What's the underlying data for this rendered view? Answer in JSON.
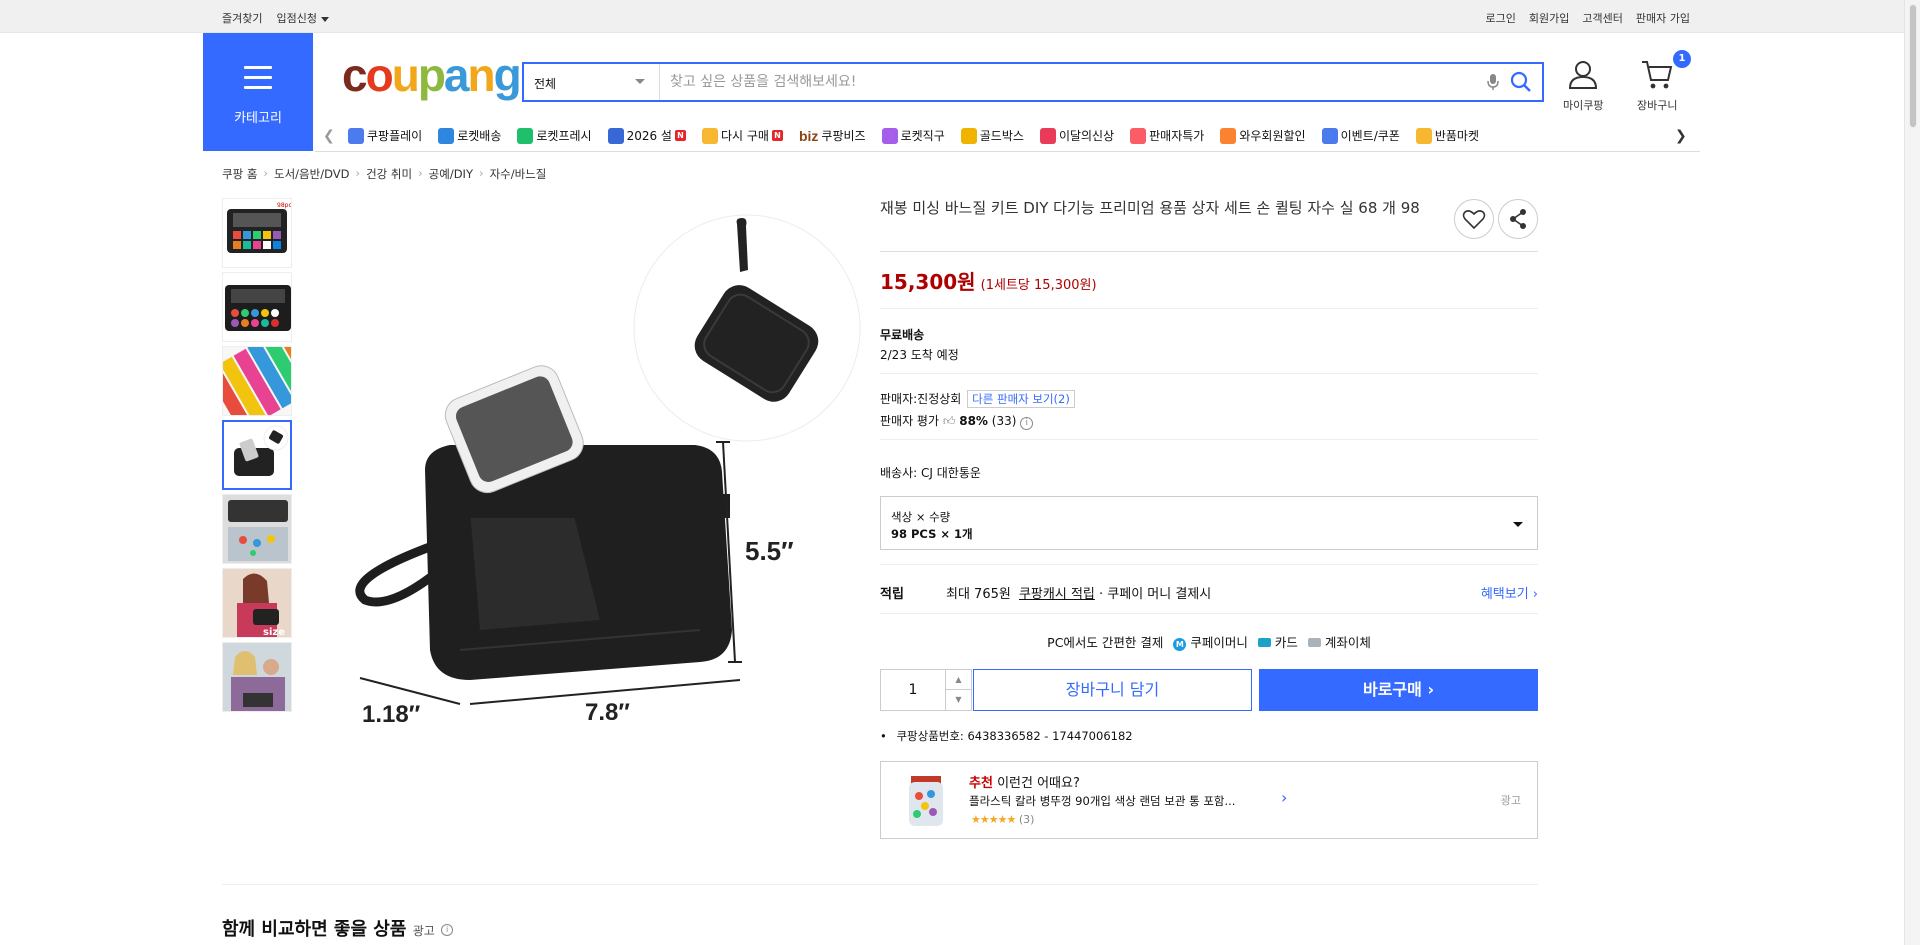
{
  "topbar": {
    "favorites": "즐겨찾기",
    "vendor_apply": "입점신청",
    "login": "로그인",
    "signup": "회원가입",
    "customer_center": "고객센터",
    "seller_join": "판매자 가입"
  },
  "header": {
    "category_label": "카테고리",
    "logo_parts": [
      "c",
      "o",
      "u",
      "p",
      "a",
      "n",
      "g"
    ],
    "search_category": "전체",
    "search_placeholder": "찾고 싶은 상품을 검색해보세요!",
    "mycoupang": "마이쿠팡",
    "cart": "장바구니",
    "cart_count": "1"
  },
  "nav": {
    "items": [
      {
        "label": "쿠팡플레이",
        "icon": "coupang-play-icon",
        "color": "#4b7bec"
      },
      {
        "label": "로켓배송",
        "icon": "rocket-icon",
        "color": "#2e86de"
      },
      {
        "label": "로켓프레시",
        "icon": "rocket-fresh-icon",
        "color": "#20bf6b"
      },
      {
        "label": "2026 설",
        "icon": "newyear-icon",
        "color": "#3867d6",
        "badge": "N"
      },
      {
        "label": "다시 구매",
        "icon": "home-icon",
        "color": "#f7b731",
        "badge": "N"
      },
      {
        "label": "쿠팡비즈",
        "icon": "biz-icon",
        "color": "#8b4513",
        "prefix": "biz"
      },
      {
        "label": "로켓직구",
        "icon": "rocket-global-icon",
        "color": "#a55eea"
      },
      {
        "label": "골드박스",
        "icon": "goldbox-icon",
        "color": "#f0b400"
      },
      {
        "label": "이달의신상",
        "icon": "new-items-icon",
        "color": "#eb3b5a"
      },
      {
        "label": "판매자특가",
        "icon": "seller-deal-icon",
        "color": "#fc5c65"
      },
      {
        "label": "와우회원할인",
        "icon": "wow-icon",
        "color": "#fa8231"
      },
      {
        "label": "이벤트/쿠폰",
        "icon": "coupon-icon",
        "color": "#4b7bec"
      },
      {
        "label": "반품마켓",
        "icon": "return-market-icon",
        "color": "#f7b731"
      }
    ]
  },
  "breadcrumb": [
    "쿠팡 홈",
    "도서/음반/DVD",
    "건강 취미",
    "공예/DIY",
    "자수/바느질"
  ],
  "product": {
    "title": "재봉 미싱 바느질 키트 DIY 다기능 프리미엄 용품 상자 세트 손 퀼팅 자수 실 68 개 98",
    "price": "15,300원",
    "unit_price": "(1세트당 15,300원)",
    "shipping_label": "무료배송",
    "arrival": "2/23 도착 예정",
    "seller_label": "판매자:",
    "seller_name": "진정상회",
    "other_sellers": "다른 판매자 보기(2)",
    "seller_rating_label": "판매자 평가",
    "seller_rating_pct": "88%",
    "seller_rating_count": "(33)",
    "carrier_label": "배송사:",
    "carrier": "CJ 대한통운",
    "option_label": "색상 × 수량",
    "option_value": "98 PCS × 1개",
    "reward_label": "적립",
    "reward_text_pre": "최대 765원",
    "reward_link": "쿠팡캐시 적립",
    "reward_text_post": "· 쿠페이 머니 결제시",
    "benefit_link": "혜택보기",
    "pay_title": "PC에서도 간편한 결제",
    "pay_methods": [
      "쿠페이머니",
      "카드",
      "계좌이체"
    ],
    "quantity": "1",
    "add_to_cart": "장바구니 담기",
    "buy_now": "바로구매",
    "product_no_label": "쿠팡상품번호:",
    "product_no": "6438336582 - 17447006182"
  },
  "image_labels": {
    "height": "5.5″",
    "depth": "1.18″",
    "width": "7.8″"
  },
  "recommend": {
    "tag": "추천",
    "title": "이런건 어때요?",
    "item": "플라스틱 칼라 병뚜껑 90개입 색상 랜덤 보관 통 포함...",
    "stars": 5,
    "count": "(3)",
    "ad": "광고"
  },
  "compare": {
    "title": "함께 비교하면 좋을 상품",
    "ad": "광고"
  },
  "colors": {
    "accent": "#346aff",
    "price": "#ae0000"
  }
}
